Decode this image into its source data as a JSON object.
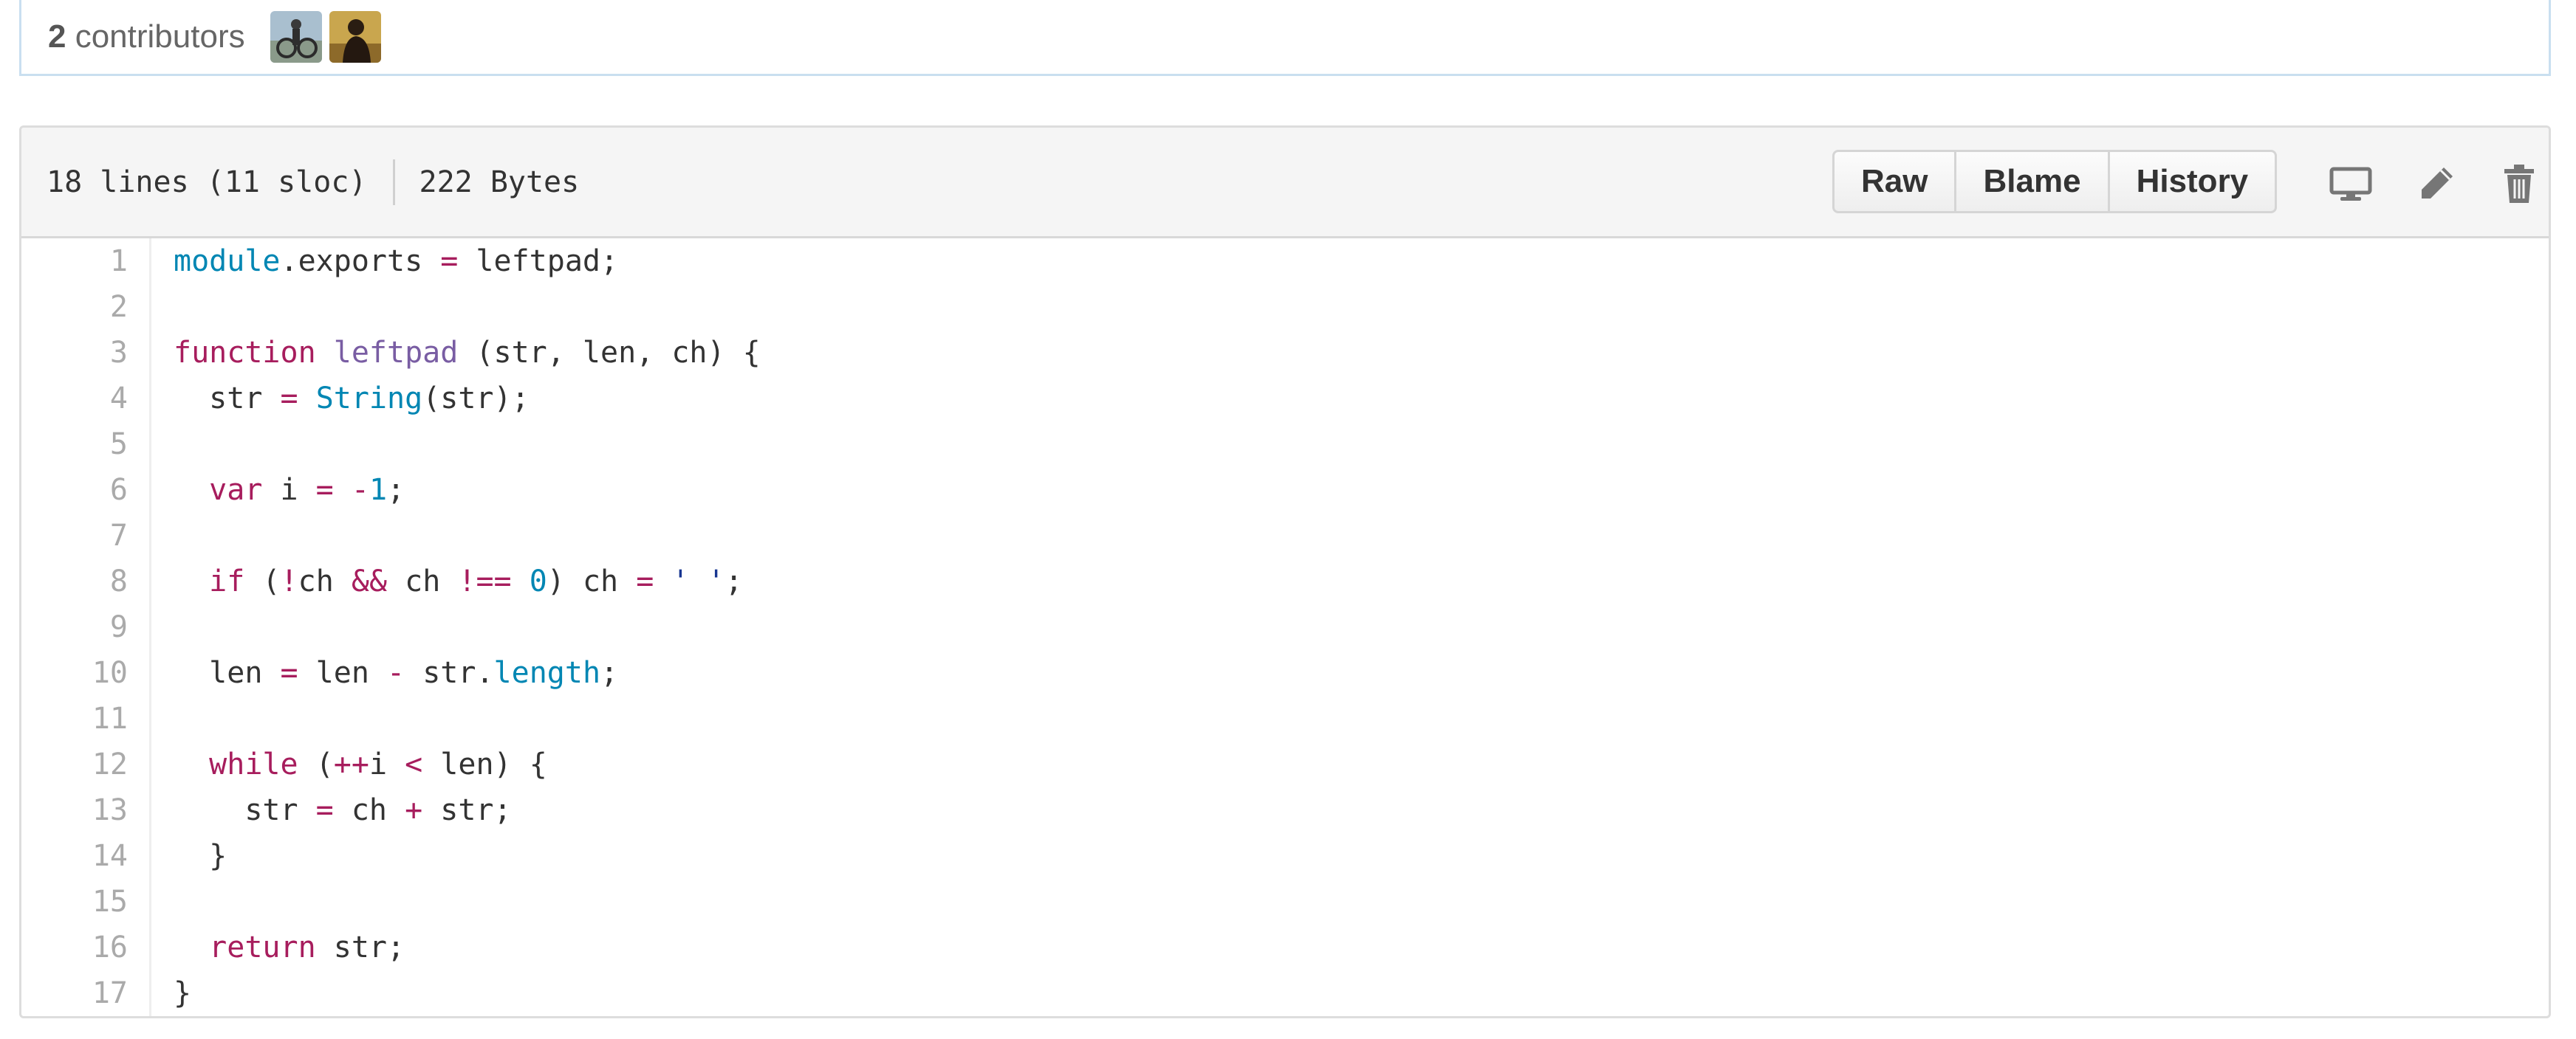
{
  "contributors": {
    "count": "2",
    "label": " contributors",
    "avatars": [
      {
        "name": "contributor-1"
      },
      {
        "name": "contributor-2"
      }
    ]
  },
  "file": {
    "lines_info": "18 lines (11 sloc)",
    "size": "222 Bytes",
    "buttons": {
      "raw": "Raw",
      "blame": "Blame",
      "history": "History"
    },
    "icons": [
      "desktop-icon",
      "pencil-icon",
      "trash-icon"
    ]
  },
  "code": {
    "language": "javascript",
    "lines": [
      {
        "n": "1",
        "tokens": [
          [
            "bi",
            "module"
          ],
          [
            "pl",
            ".exports "
          ],
          [
            "op",
            "="
          ],
          [
            "pl",
            " leftpad;"
          ]
        ]
      },
      {
        "n": "2",
        "tokens": []
      },
      {
        "n": "3",
        "tokens": [
          [
            "kw",
            "function"
          ],
          [
            "pl",
            " "
          ],
          [
            "fn",
            "leftpad"
          ],
          [
            "pl",
            " (str, len, ch) {"
          ]
        ]
      },
      {
        "n": "4",
        "tokens": [
          [
            "pl",
            "  str "
          ],
          [
            "op",
            "="
          ],
          [
            "pl",
            " "
          ],
          [
            "bi",
            "String"
          ],
          [
            "pl",
            "(str);"
          ]
        ]
      },
      {
        "n": "5",
        "tokens": []
      },
      {
        "n": "6",
        "tokens": [
          [
            "pl",
            "  "
          ],
          [
            "kw",
            "var"
          ],
          [
            "pl",
            " i "
          ],
          [
            "op",
            "="
          ],
          [
            "pl",
            " "
          ],
          [
            "op",
            "-"
          ],
          [
            "num",
            "1"
          ],
          [
            "pl",
            ";"
          ]
        ]
      },
      {
        "n": "7",
        "tokens": []
      },
      {
        "n": "8",
        "tokens": [
          [
            "pl",
            "  "
          ],
          [
            "kw",
            "if"
          ],
          [
            "pl",
            " ("
          ],
          [
            "op",
            "!"
          ],
          [
            "pl",
            "ch "
          ],
          [
            "op",
            "&&"
          ],
          [
            "pl",
            " ch "
          ],
          [
            "op",
            "!=="
          ],
          [
            "pl",
            " "
          ],
          [
            "num",
            "0"
          ],
          [
            "pl",
            ") ch "
          ],
          [
            "op",
            "="
          ],
          [
            "pl",
            " "
          ],
          [
            "str",
            "' '"
          ],
          [
            "pl",
            ";"
          ]
        ]
      },
      {
        "n": "9",
        "tokens": []
      },
      {
        "n": "10",
        "tokens": [
          [
            "pl",
            "  len "
          ],
          [
            "op",
            "="
          ],
          [
            "pl",
            " len "
          ],
          [
            "op",
            "-"
          ],
          [
            "pl",
            " str."
          ],
          [
            "bi",
            "length"
          ],
          [
            "pl",
            ";"
          ]
        ]
      },
      {
        "n": "11",
        "tokens": []
      },
      {
        "n": "12",
        "tokens": [
          [
            "pl",
            "  "
          ],
          [
            "kw",
            "while"
          ],
          [
            "pl",
            " ("
          ],
          [
            "op",
            "++"
          ],
          [
            "pl",
            "i "
          ],
          [
            "op",
            "<"
          ],
          [
            "pl",
            " len) {"
          ]
        ]
      },
      {
        "n": "13",
        "tokens": [
          [
            "pl",
            "    str "
          ],
          [
            "op",
            "="
          ],
          [
            "pl",
            " ch "
          ],
          [
            "op",
            "+"
          ],
          [
            "pl",
            " str;"
          ]
        ]
      },
      {
        "n": "14",
        "tokens": [
          [
            "pl",
            "  }"
          ]
        ]
      },
      {
        "n": "15",
        "tokens": []
      },
      {
        "n": "16",
        "tokens": [
          [
            "pl",
            "  "
          ],
          [
            "kw",
            "return"
          ],
          [
            "pl",
            " str;"
          ]
        ]
      },
      {
        "n": "17",
        "tokens": [
          [
            "pl",
            "}"
          ]
        ]
      }
    ]
  },
  "colors": {
    "keyword": "#a71d5d",
    "function_name": "#795da3",
    "builtin": "#0086b3",
    "string": "#183691",
    "line_number": "#aaaaaa",
    "header_bg": "#f5f5f5",
    "contrib_border": "#c9dff0"
  }
}
